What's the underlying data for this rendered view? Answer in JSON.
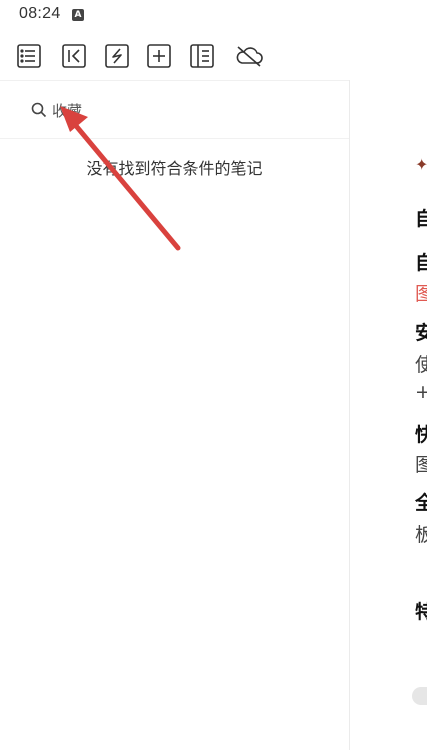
{
  "status_bar": {
    "time": "08:24",
    "badge_letter": "A"
  },
  "toolbar": {
    "buttons": [
      {
        "icon": "list-icon"
      },
      {
        "icon": "collapse-left-icon"
      },
      {
        "icon": "lightning-icon"
      },
      {
        "icon": "plus-icon"
      },
      {
        "icon": "sidebar-panel-icon"
      },
      {
        "icon": "cloud-off-icon"
      }
    ]
  },
  "search": {
    "query": "收藏",
    "icon": "search-icon"
  },
  "notes_list": {
    "empty_message": "没有找到符合条件的笔记"
  },
  "editor_preview": {
    "lines": [
      {
        "text": "自",
        "style": "bold"
      },
      {
        "text": "自",
        "style": "bold"
      },
      {
        "text": "图",
        "style": "red"
      },
      {
        "text": "安",
        "style": "bold"
      },
      {
        "text": "使",
        "style": "normal"
      },
      {
        "text": "+",
        "style": "normal"
      },
      {
        "text": "快",
        "style": "bold"
      },
      {
        "text": "图",
        "style": "normal"
      },
      {
        "text": "全",
        "style": "bold"
      },
      {
        "text": "板",
        "style": "normal"
      },
      {
        "text": "特",
        "style": "bold"
      }
    ]
  },
  "colors": {
    "annotation_arrow": "#d9423e",
    "accent_red_text": "#e05a52"
  }
}
